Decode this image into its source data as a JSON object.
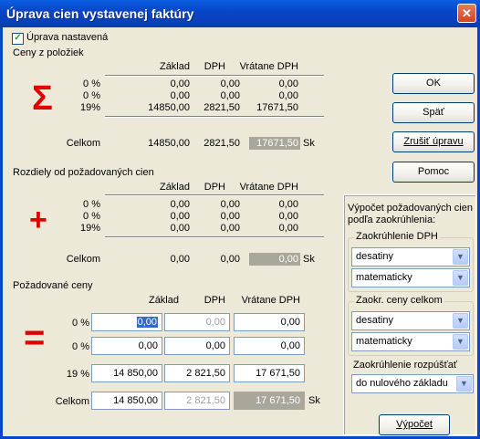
{
  "window": {
    "title": "Úprava cien vystavenej faktúry",
    "close_glyph": "✕"
  },
  "checkbox": {
    "label": "Úprava nastavená",
    "checked": true
  },
  "col": {
    "zaklad": "Základ",
    "dph": "DPH",
    "vratane": "Vrátane DPH"
  },
  "total_label": "Celkom",
  "currency": "Sk",
  "symbols": {
    "sum": "Σ",
    "plus": "+",
    "equals": "="
  },
  "sec1": {
    "title": "Ceny z položiek",
    "rows": [
      {
        "rate": "0 %",
        "zaklad": "0,00",
        "dph": "0,00",
        "vratane": "0,00"
      },
      {
        "rate": "0 %",
        "zaklad": "0,00",
        "dph": "0,00",
        "vratane": "0,00"
      },
      {
        "rate": "19%",
        "zaklad": "14850,00",
        "dph": "2821,50",
        "vratane": "17671,50"
      }
    ],
    "total": {
      "zaklad": "14850,00",
      "dph": "2821,50",
      "vratane": "17671,50"
    }
  },
  "sec2": {
    "title": "Rozdiely od požadovaných cien",
    "rows": [
      {
        "rate": "0 %",
        "zaklad": "0,00",
        "dph": "0,00",
        "vratane": "0,00"
      },
      {
        "rate": "0 %",
        "zaklad": "0,00",
        "dph": "0,00",
        "vratane": "0,00"
      },
      {
        "rate": "19%",
        "zaklad": "0,00",
        "dph": "0,00",
        "vratane": "0,00"
      }
    ],
    "total": {
      "zaklad": "0,00",
      "dph": "0,00",
      "vratane": "0,00"
    }
  },
  "sec3": {
    "title": "Požadované ceny",
    "rows": [
      {
        "rate": "0 %",
        "zaklad": "0,00",
        "dph": "0,00",
        "vratane": "0,00"
      },
      {
        "rate": "0 %",
        "zaklad": "0,00",
        "dph": "0,00",
        "vratane": "0,00"
      },
      {
        "rate": "19 %",
        "zaklad": "14 850,00",
        "dph": "2 821,50",
        "vratane": "17 671,50"
      }
    ],
    "total": {
      "zaklad": "14 850,00",
      "dph": "2 821,50",
      "vratane": "17 671,50"
    }
  },
  "buttons": {
    "ok": "OK",
    "back": "Späť",
    "cancel": "Zrušiť úpravu",
    "help": "Pomoc",
    "calc": "Výpočet"
  },
  "panel": {
    "title_line1": "Výpočet požadovaných cien",
    "title_line2": "podľa zaokrúhlenia:",
    "grp_dph": {
      "label": "Zaokrúhlenie DPH",
      "combo1": "desatiny",
      "combo2": "matematicky"
    },
    "grp_total": {
      "label": "Zaokr. ceny celkom",
      "combo1": "desatiny",
      "combo2": "matematicky"
    },
    "rozpust": {
      "label": "Zaokrúhlenie rozpúšťať",
      "combo": "do nulového základu"
    }
  },
  "colors": {
    "accent": "#E00000",
    "title_bar": "#0846C8",
    "readonly_fill": "#A9A69A"
  }
}
